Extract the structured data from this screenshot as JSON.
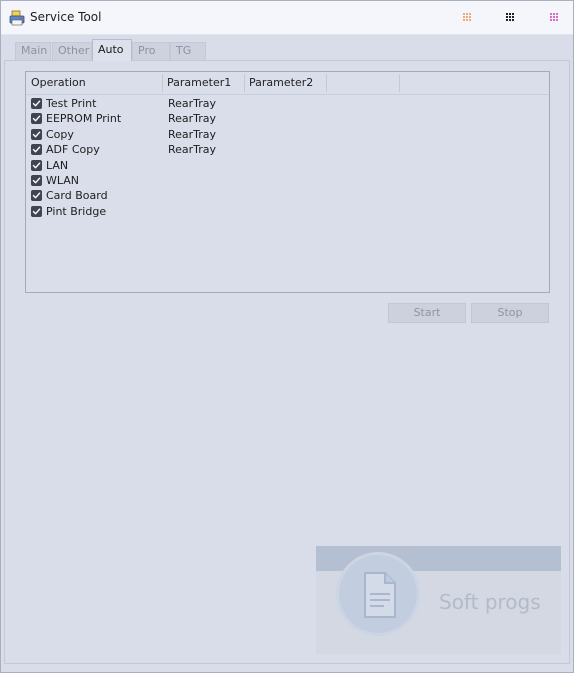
{
  "window": {
    "title": "Service Tool"
  },
  "titlebar_buttons": [
    {
      "name": "grid-icon-orange",
      "color": "#f0a070"
    },
    {
      "name": "grid-icon-dark",
      "color": "#222222"
    },
    {
      "name": "grid-icon-pink",
      "color": "#d070c0"
    }
  ],
  "tabs": [
    {
      "label": "Main",
      "active": false
    },
    {
      "label": "Other",
      "active": false
    },
    {
      "label": "Auto",
      "active": true
    },
    {
      "label": "Pro",
      "active": false
    },
    {
      "label": "TG",
      "active": false
    }
  ],
  "list": {
    "columns": [
      "Operation",
      "Parameter1",
      "Parameter2",
      ""
    ],
    "rows": [
      {
        "checked": true,
        "operation": "Test Print",
        "parameter1": "RearTray"
      },
      {
        "checked": true,
        "operation": "EEPROM Print",
        "parameter1": "RearTray"
      },
      {
        "checked": true,
        "operation": "Copy",
        "parameter1": "RearTray"
      },
      {
        "checked": true,
        "operation": "ADF Copy",
        "parameter1": "RearTray"
      },
      {
        "checked": true,
        "operation": "LAN",
        "parameter1": ""
      },
      {
        "checked": true,
        "operation": "WLAN",
        "parameter1": ""
      },
      {
        "checked": true,
        "operation": "Card Board",
        "parameter1": ""
      },
      {
        "checked": true,
        "operation": "Pint Bridge",
        "parameter1": ""
      }
    ]
  },
  "buttons": {
    "start_label": "Start",
    "stop_label": "Stop"
  },
  "watermark": {
    "text": "Soft progs",
    "icon": "document-icon"
  },
  "colors": {
    "window_bg": "#d9dde9",
    "checkbox": "#3e4452"
  }
}
